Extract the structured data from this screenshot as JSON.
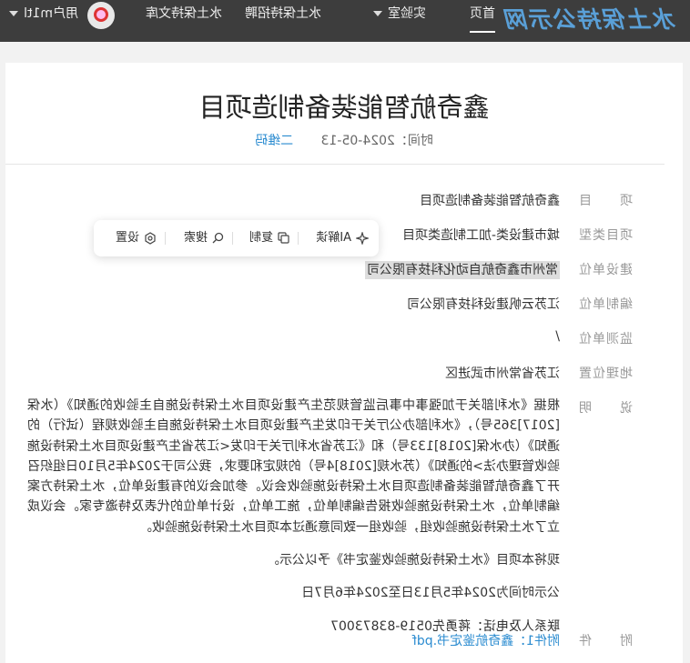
{
  "site": {
    "logo": "水土保持公示网"
  },
  "nav": {
    "items": [
      "首页",
      "实验室",
      "水土保持招聘",
      "水土保持文库"
    ],
    "user": "用户m1tl"
  },
  "article": {
    "title": "鑫奇航智能装备制造项目",
    "time_label": "时间：2024-05-13",
    "qr_label": "二维码"
  },
  "toolbar": {
    "ai_label": "AI解读",
    "copy_label": "复制",
    "search_label": "搜索",
    "settings_label": "设置"
  },
  "fields": [
    {
      "label": "项　　目",
      "value": "鑫奇航智能装备制造项目"
    },
    {
      "label": "项目类型",
      "value": "城市建设类-加工制造类项目"
    },
    {
      "label": "建设单位",
      "value": "常州市鑫奇航自动化科技有限公司"
    },
    {
      "label": "编制单位",
      "value": "江苏云帆建设科技有限公司"
    },
    {
      "label": "监测单位",
      "value": "/"
    },
    {
      "label": "地理位置",
      "value": "江苏省常州市武进区"
    },
    {
      "label": "说　　明",
      "value": ""
    },
    {
      "label": "附　　件",
      "value": ""
    }
  ],
  "description": {
    "p1": "根据《水利部关于加强事中事后监管规范生产建设项目水土保持设施自主验收的通知》（水保[2017]365号），《水利部办公厅关于印发生产建设项目水土保持设施自主验收规程（试行）的通知》（办水保[2018]133号）和《江苏省水利厅关于印发<江苏省生产建设项目水土保持设施验收管理办法>的通知》（苏水规[2018]4号）的规定和要求，我公司于2024年5月10日组织召开了鑫奇航智能装备制造项目水土保持设施验收会议。参加会议的有建设单位，水土保持方案编制单位，水土保持设施验收报告编制单位，施工单位，设计单位的代表及特邀专家。会议成立了水土保持设施验收组，验收组一致同意通过本项目水土保持设施验收。",
    "p2": "现将本项目《水土保持设施验收鉴定书》予以公示。",
    "p3": "公示时间为2024年5月13日至2024年6月7日",
    "p4": "联系人及电话：蒋勇先0519-83873007"
  },
  "attachment": {
    "label": "附件1：",
    "file": "鑫奇航鉴定书.pdf"
  }
}
